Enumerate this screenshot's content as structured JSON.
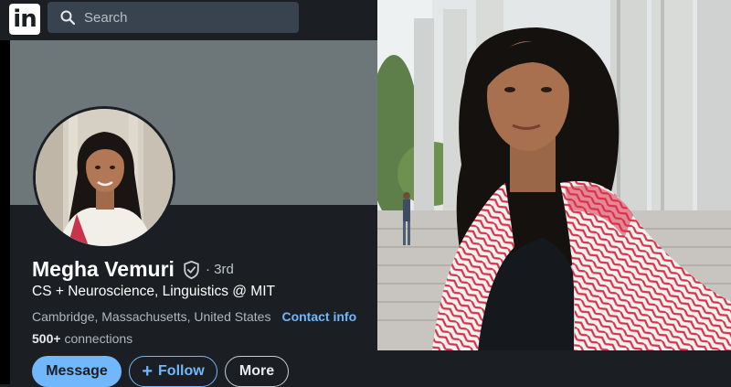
{
  "topbar": {
    "logo_text": "in",
    "search_placeholder": "Search"
  },
  "profile": {
    "name": "Megha Vemuri",
    "degree": "· 3rd",
    "headline": "CS + Neuroscience, Linguistics @ MIT",
    "location": "Cambridge, Massachusetts, United States",
    "contact_info": "Contact info",
    "connections_count": "500+",
    "connections_label": "connections"
  },
  "actions": {
    "message": "Message",
    "follow": "Follow",
    "more": "More"
  },
  "colors": {
    "accent": "#71b7fb",
    "background": "#1b1f23",
    "banner": "#6d7779",
    "scarf_red": "#d8324a"
  },
  "icons": [
    "linkedin-logo-icon",
    "search-icon",
    "verified-shield-icon",
    "plus-icon"
  ]
}
